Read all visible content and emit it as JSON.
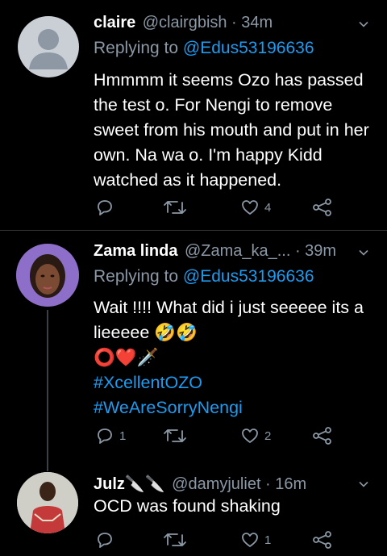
{
  "tweets": [
    {
      "name": "claire",
      "handle": "@clairgbish · 34m",
      "replying_label": "Replying to",
      "replying_handle": "@Edus53196636",
      "lines": [
        "Hmmmm it seems Ozo has passed",
        "the test o. For Nengi to remove",
        "sweet from his mouth and put in her",
        "own. Na wa o. I'm happy Kidd",
        "watched as it happened."
      ],
      "reply_count": "",
      "retweet_count": "",
      "like_count": "4"
    },
    {
      "name": "Zama linda",
      "handle": "@Zama_ka_... · 39m",
      "replying_label": "Replying to",
      "replying_handle": "@Edus53196636",
      "lines": [
        "Wait !!!! What did i just seeeee its a",
        "lieeeee 🤣🤣",
        "⭕❤️🗡️"
      ],
      "hashtags": [
        "#XcellentOZO",
        "#WeAreSorryNengi"
      ],
      "reply_count": "1",
      "retweet_count": "",
      "like_count": "2"
    },
    {
      "name": "Julz🔪🔪",
      "handle": "@damyjuliet · 16m",
      "lines": [
        "OCD was found shaking"
      ],
      "reply_count": "",
      "retweet_count": "",
      "like_count": "1"
    }
  ],
  "colors": {
    "background": "#000000",
    "text": "#ffffff",
    "secondary": "#8b98a5",
    "accent": "#1d9bf0",
    "divider": "#2f3336"
  },
  "icons": [
    "default-avatar-icon",
    "chevron-down-icon",
    "reply-icon",
    "retweet-icon",
    "like-icon",
    "share-icon"
  ]
}
